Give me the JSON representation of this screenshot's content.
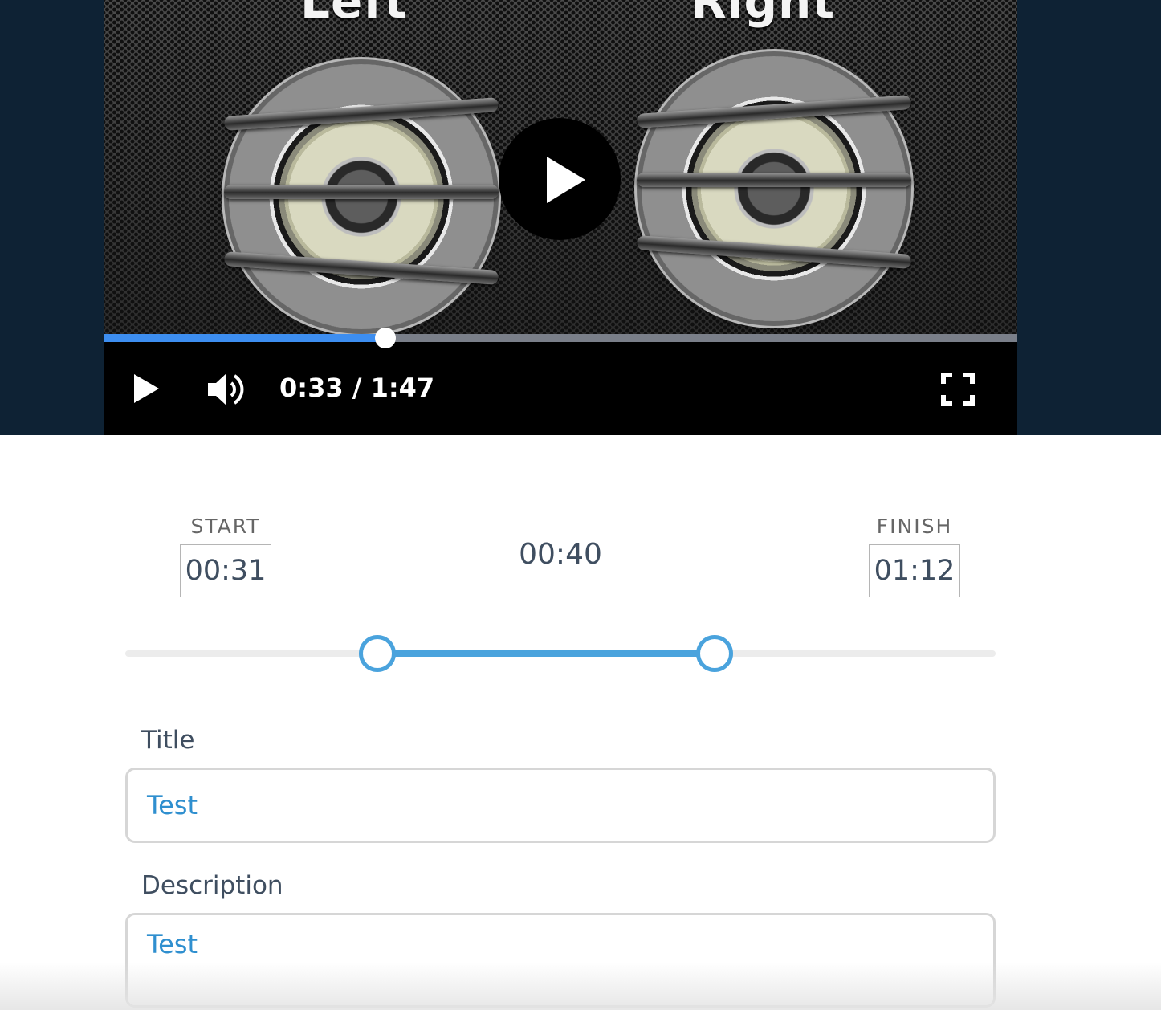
{
  "video": {
    "channel_left": "Left",
    "channel_right": "Right",
    "current_time": "0:33",
    "separator": "/",
    "duration": "1:47",
    "progress_fraction": 0.308,
    "accent_color": "#3d8ef0"
  },
  "trim": {
    "start_label": "START",
    "start_value": "00:31",
    "finish_label": "FINISH",
    "finish_value": "01:12",
    "clip_length": "00:40",
    "range_start_fraction": 0.29,
    "range_end_fraction": 0.677,
    "accent_color": "#4aa3dd"
  },
  "form": {
    "title_label": "Title",
    "title_value": "Test",
    "description_label": "Description",
    "description_value": "Test"
  }
}
